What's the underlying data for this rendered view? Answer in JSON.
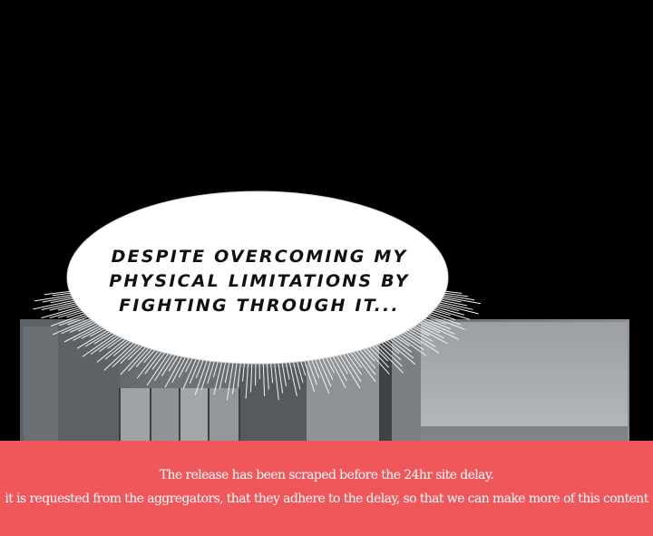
{
  "panel": {
    "speech_bubble": {
      "lines": [
        "DESPITE OVERCOMING MY",
        "PHYSICAL LIMITATIONS BY",
        "FIGHTING THROUGH IT..."
      ]
    }
  },
  "notice_banner": {
    "line1": "The release has been scraped before the 24hr site delay.",
    "line2": "it is requested from the aggregators, that they adhere to the delay, so that we can make more of this content",
    "color": "#f0575a"
  }
}
